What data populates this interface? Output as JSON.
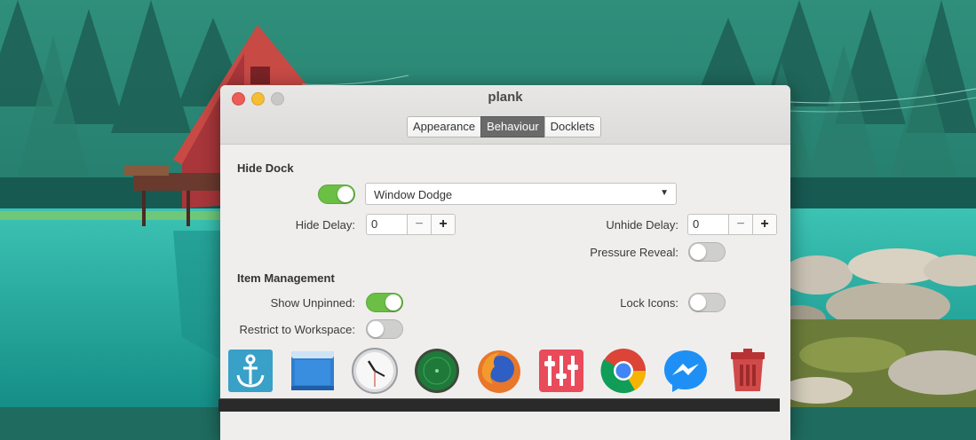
{
  "window": {
    "title": "plank",
    "tabs": [
      "Appearance",
      "Behaviour",
      "Docklets"
    ],
    "active_tab": "Behaviour"
  },
  "hide_dock": {
    "heading": "Hide Dock",
    "enabled": true,
    "mode_value": "Window Dodge",
    "hide_delay_label": "Hide Delay:",
    "hide_delay_value": "0",
    "unhide_delay_label": "Unhide Delay:",
    "unhide_delay_value": "0",
    "pressure_reveal_label": "Pressure Reveal:",
    "pressure_reveal": false
  },
  "item_management": {
    "heading": "Item Management",
    "show_unpinned_label": "Show Unpinned:",
    "show_unpinned": true,
    "lock_icons_label": "Lock Icons:",
    "lock_icons": false,
    "restrict_workspace_label": "Restrict to Workspace:",
    "restrict_workspace": false
  },
  "spin": {
    "minus": "−",
    "plus": "+"
  },
  "dock": {
    "items": [
      "plank-anchor-icon",
      "window-app-icon",
      "clock-icon",
      "radar-icon",
      "firefox-icon",
      "mixer-icon",
      "chrome-icon",
      "messenger-icon",
      "trash-icon"
    ]
  },
  "colors": {
    "toggle_on": "#6bbf44",
    "active_tab": "#6a6a6a",
    "close": "#ec5c58",
    "minimize": "#f5bd34"
  }
}
